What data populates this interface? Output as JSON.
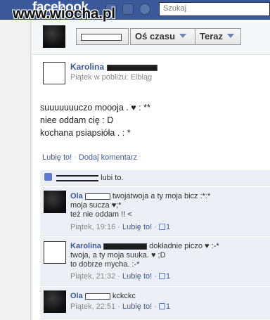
{
  "header": {
    "logo": "facebook",
    "watermark": "www.wiocha.pl",
    "search_placeholder": "Szukaj"
  },
  "filter": {
    "timeline_label": "Oś czasu",
    "now_label": "Teraz"
  },
  "post": {
    "author": "Karolina",
    "meta": "Piątek w pobliżu: Elbląg",
    "lines": [
      "suuuuuuuczo moooja . ♥ : **",
      "niee oddam cię : D",
      "kochana psiapsióła . : *"
    ],
    "like_label": "Lubię to!",
    "comment_label": "Dodaj komentarz",
    "likes_text": "lubi to."
  },
  "comments": [
    {
      "author": "Ola",
      "text_first": "twojatwoja a ty moja bicz :*:*",
      "lines": [
        "moja sucza ♥;*",
        "też nie oddam !! <"
      ],
      "time": "Piątek, 19:16",
      "like": "Lubię to!",
      "likes": "1"
    },
    {
      "author": "Karolina",
      "text_first": "dokładnie piczo ♥ :-*",
      "lines": [
        "twoja, a ty moja suuka. ♥ ;D",
        "to dobrze mycha. :-*"
      ],
      "time": "Piątek, 21:32",
      "like": "Lubię to!",
      "likes": "1"
    },
    {
      "author": "Ola",
      "text_first": "kckckc",
      "lines": [],
      "time": "Piątek, 22:51",
      "like": "Lubię to!",
      "likes": "1"
    }
  ],
  "colors": {
    "brand": "#3b5998",
    "link": "#3b5998",
    "comment_bg": "#eceff5"
  }
}
